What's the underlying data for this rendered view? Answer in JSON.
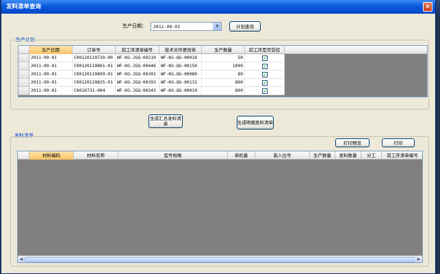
{
  "window": {
    "title": "发料清单查询",
    "close_glyph": "×"
  },
  "filter": {
    "date_label": "生产日期：",
    "date_value": "2011-09-01",
    "query_button": "计划查询"
  },
  "plan": {
    "group_title": "生产计划",
    "columns": [
      "生产日期",
      "订单号",
      "前工序清单编号",
      "技术文件更改单",
      "生产数量",
      "前工序是否受控"
    ],
    "rows": [
      {
        "date": "2011-09-01",
        "order": "C00120110720-00",
        "prev": "WF-KG-JGQ-00210",
        "tech": "WF-KG-QG-00018",
        "qty": "50",
        "ctrl": "✔"
      },
      {
        "date": "2011-09-01",
        "order": "C00120110801-01",
        "prev": "WF-KG-JGQ-00446",
        "tech": "WF-KG-QG-00150",
        "qty": "1000",
        "ctrl": "✔"
      },
      {
        "date": "2011-09-01",
        "order": "C00120110809-01",
        "prev": "WF-KG-JGQ-00301",
        "tech": "WF-KG-QG-00080",
        "qty": "80",
        "ctrl": "✔"
      },
      {
        "date": "2011-09-01",
        "order": "C00120110825-01",
        "prev": "WF-KG-JGQ-00393",
        "tech": "WF-KG-QG-00131",
        "qty": "800",
        "ctrl": "✔"
      },
      {
        "date": "2011-09-01",
        "order": "C0010731-004",
        "prev": "WF-KG-JGQ-00243",
        "tech": "WF-KG-QG-00019",
        "qty": "800",
        "ctrl": "✔"
      }
    ]
  },
  "actions": {
    "summary_button": "生成汇总发料清单",
    "detail_button": "生成明细发料清单"
  },
  "issue": {
    "group_title": "发料清单",
    "preview_button": "打印预览",
    "print_button": "打印",
    "columns": [
      "材料编码",
      "材料名称",
      "型号规格",
      "单机量",
      "装入位号",
      "生产数量",
      "发料数量",
      "分工",
      "前工序清单编号"
    ]
  }
}
